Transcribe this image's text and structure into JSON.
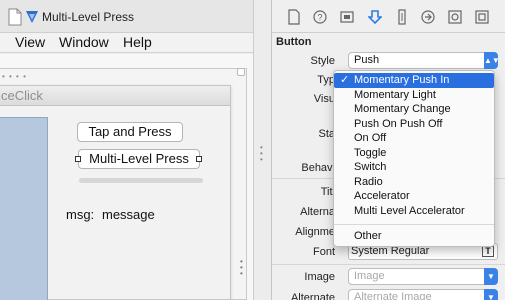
{
  "window": {
    "title": "Multi-Level Press",
    "doc_icon": "document-icon",
    "app_icon": "xcode-app-icon"
  },
  "menubar": {
    "items": [
      "View",
      "Window",
      "Help"
    ]
  },
  "canvas": {
    "controller_title": "ceClick",
    "button_tap_label": "Tap and Press",
    "button_multi_label": "Multi-Level Press",
    "msg_label": "msg:",
    "msg_value": "message"
  },
  "inspector": {
    "tabs": [
      "file-icon",
      "help-icon",
      "identity-icon",
      "attributes-icon",
      "size-icon",
      "connections-icon",
      "bindings-icon",
      "effects-icon"
    ],
    "section": "Button",
    "rows": {
      "style_label": "Style",
      "style_value": "Push",
      "type_label": "Typ",
      "visual_label": "Visu",
      "state_label": "Sta",
      "behavior_label": "Behavi",
      "title_label": "Titl",
      "alternate_label": "Alterna",
      "alignment_label": "Alignme",
      "font_label": "Font",
      "font_value": "System Regular",
      "font_button": "T",
      "image_label": "Image",
      "image_placeholder": "Image",
      "alternate2_label": "Alternate",
      "alternate2_placeholder": "Alternate Image"
    },
    "accent_color": "#3b82e8"
  },
  "type_menu": {
    "checkmark": "✓",
    "items": [
      "Momentary Push In",
      "Momentary Light",
      "Momentary Change",
      "Push On Push Off",
      "On Off",
      "Toggle",
      "Switch",
      "Radio",
      "Accelerator",
      "Multi Level Accelerator"
    ],
    "other": "Other",
    "selected_color": "#2a6fe0"
  }
}
